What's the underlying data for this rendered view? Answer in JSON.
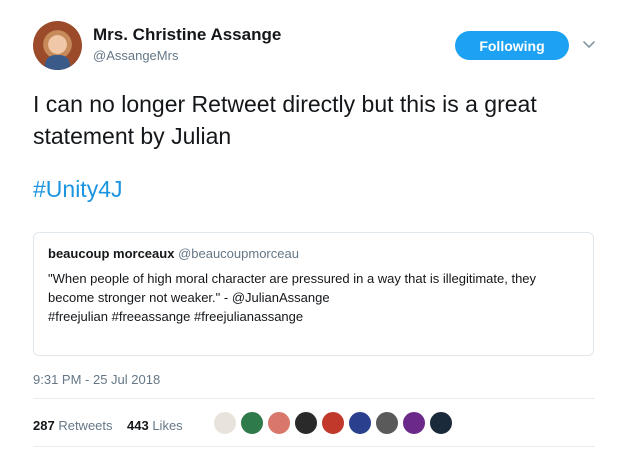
{
  "author": {
    "display_name": "Mrs. Christine Assange",
    "handle": "@AssangeMrs"
  },
  "follow_button": {
    "label": "Following"
  },
  "tweet": {
    "text": "I can no longer Retweet directly but this is a great statement by Julian",
    "hashtag": "#Unity4J"
  },
  "quoted_tweet": {
    "name": "beaucoup morceaux",
    "handle": "@beaucoupmorceau",
    "text_line1": "\"When people of high moral character are pressured in a way that is illegitimate, they",
    "text_line2": "become stronger not weaker.\" - @JulianAssange",
    "text_line3": "#freejulian #freeassange #freejulianassange"
  },
  "timestamp": "9:31 PM - 25 Jul 2018",
  "stats": {
    "retweets_count": "287",
    "retweets_label": "Retweets",
    "likes_count": "443",
    "likes_label": "Likes"
  },
  "likers": [
    {
      "color": "#e8e4dc"
    },
    {
      "color": "#2f7a4a"
    },
    {
      "color": "#d9776b"
    },
    {
      "color": "#2a2a2a"
    },
    {
      "color": "#c0392b"
    },
    {
      "color": "#2b3f8f"
    },
    {
      "color": "#5a5a5a"
    },
    {
      "color": "#6b2a8a"
    },
    {
      "color": "#1b2a3a"
    }
  ],
  "colors": {
    "accent": "#1da1f2",
    "link": "#1b95e0",
    "secondary_text": "#657786"
  }
}
